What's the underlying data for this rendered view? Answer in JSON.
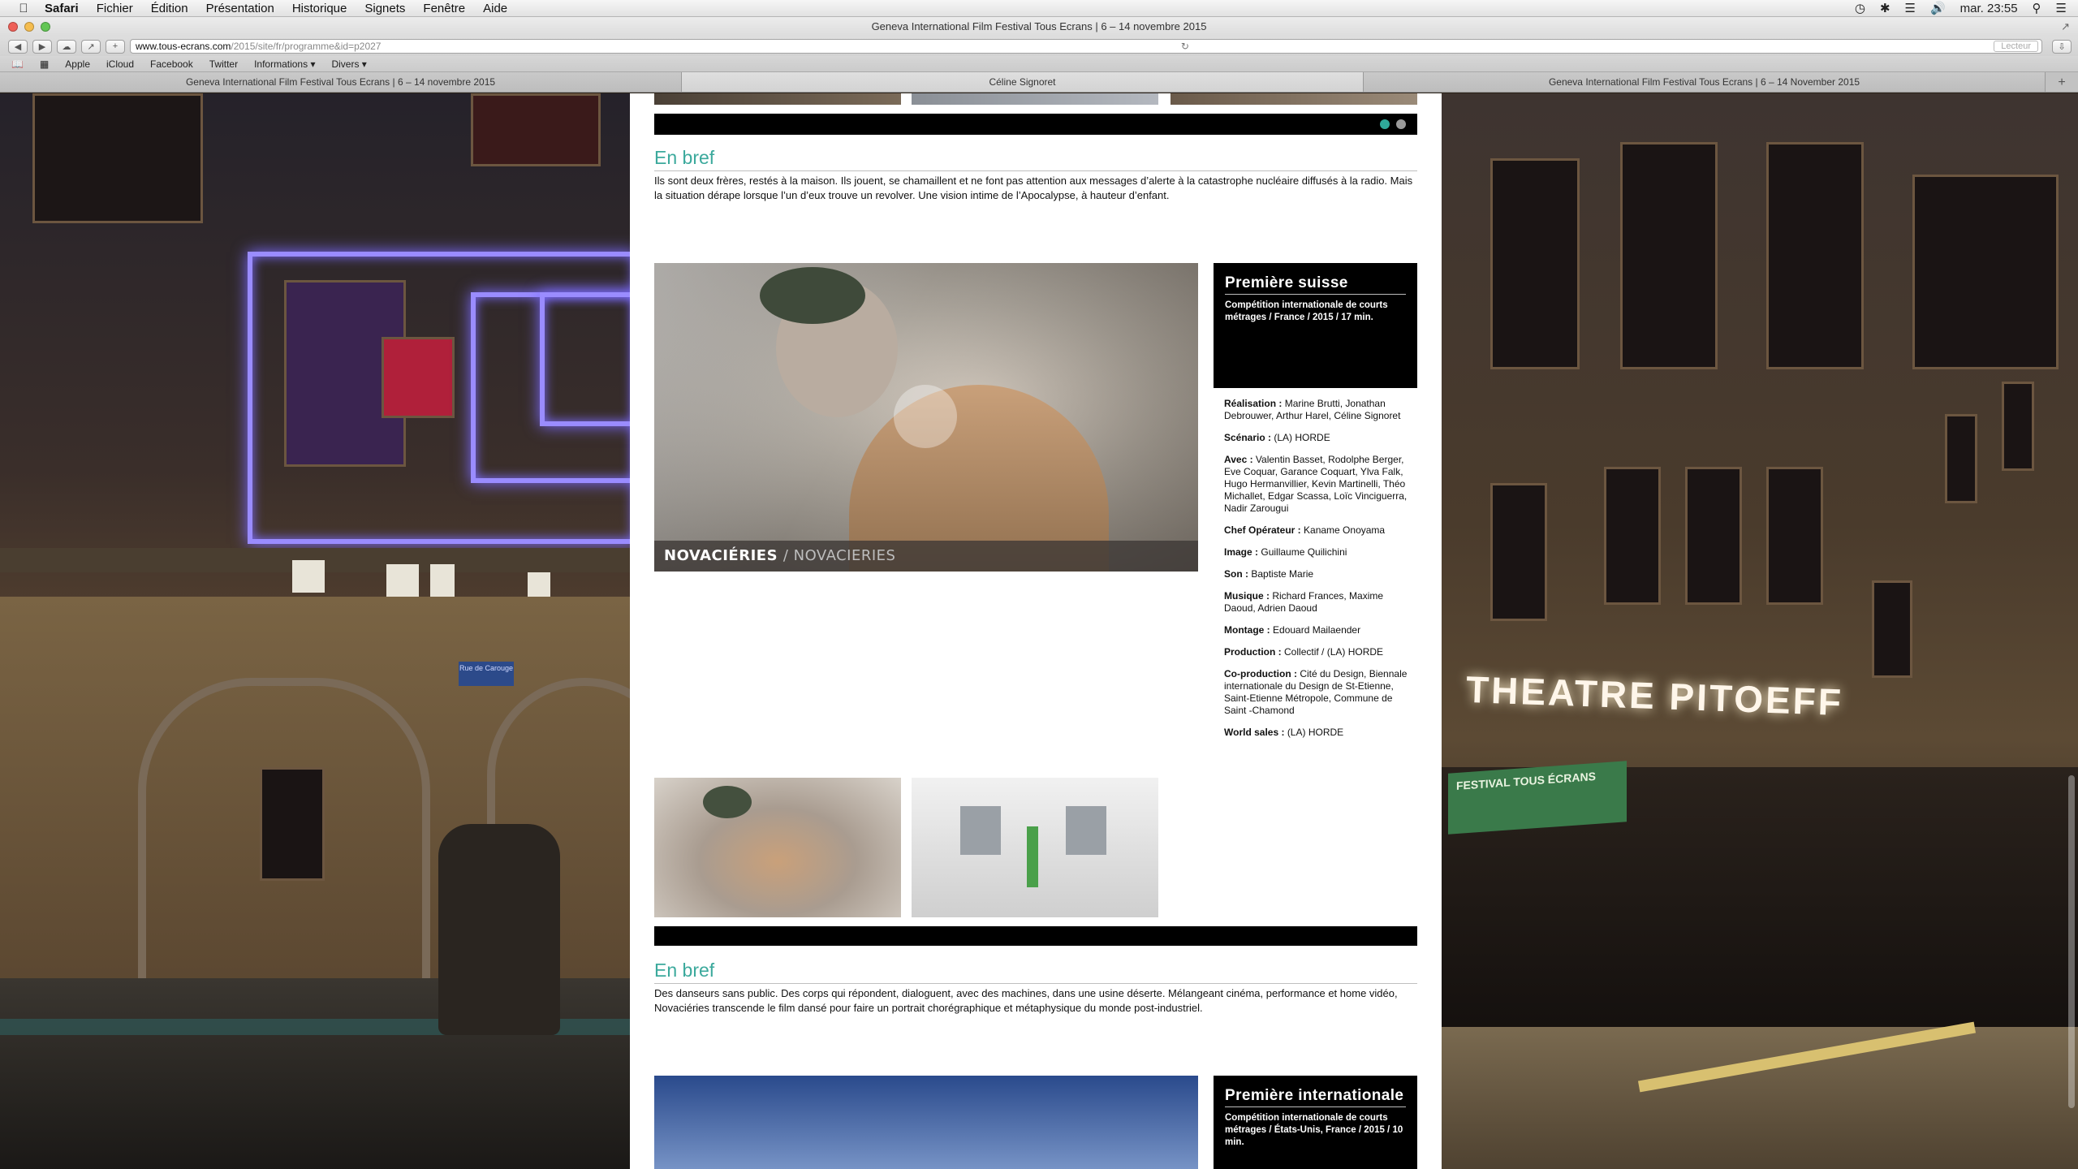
{
  "menubar": {
    "app": "Safari",
    "items": [
      "Fichier",
      "Édition",
      "Présentation",
      "Historique",
      "Signets",
      "Fenêtre",
      "Aide"
    ],
    "clock": "mar. 23:55"
  },
  "window": {
    "title": "Geneva International Film Festival Tous Ecrans | 6 – 14 novembre 2015"
  },
  "toolbar": {
    "url_host": "www.tous-ecrans.com",
    "url_path": "/2015/site/fr/programme&id=p2027",
    "reader_label": "Lecteur"
  },
  "bookmarks": [
    "Apple",
    "iCloud",
    "Facebook",
    "Twitter",
    "Informations ▾",
    "Divers ▾"
  ],
  "tabs": [
    "Geneva International Film Festival Tous Ecrans | 6 – 14 novembre 2015",
    "Céline Signoret",
    "Geneva International Film Festival Tous Ecrans | 6 – 14 November 2015"
  ],
  "background": {
    "theatre_sign": "THEATRE  PITOEFF",
    "street_sign": "Rue de Carouge",
    "banner": "FESTIVAL TOUS ÉCRANS"
  },
  "film1": {
    "section_title": "En bref",
    "synopsis": "Ils sont deux frères, restés à la maison. Ils jouent, se chamaillent et ne font pas attention aux messages d’alerte à la catastrophe nucléaire diffusés à la radio. Mais la situation dérape lorsque l’un d’eux trouve un revolver. Une vision intime de l’Apocalypse, à hauteur d’enfant."
  },
  "film2": {
    "title": "NOVACIÉRIES",
    "original_title": "/ NOVACIERIES",
    "premiere": "Première suisse",
    "category": "Compétition internationale de courts métrages / France / 2015 / 17 min.",
    "credits": [
      {
        "label": "Réalisation :",
        "value": "Marine Brutti, Jonathan Debrouwer, Arthur Harel, Céline Signoret"
      },
      {
        "label": "Scénario :",
        "value": "(LA) HORDE"
      },
      {
        "label": "Avec :",
        "value": "Valentin Basset, Rodolphe Berger, Eve Coquar, Garance Coquart, Ylva Falk, Hugo Hermanvillier, Kevin Martinelli, Théo Michallet, Edgar Scassa, Loïc Vinciguerra, Nadir Zarougui"
      },
      {
        "label": "Chef Opérateur :",
        "value": "Kaname Onoyama"
      },
      {
        "label": "Image :",
        "value": "Guillaume Quilichini"
      },
      {
        "label": "Son :",
        "value": "Baptiste Marie"
      },
      {
        "label": "Musique :",
        "value": "Richard Frances, Maxime Daoud, Adrien Daoud"
      },
      {
        "label": "Montage :",
        "value": "Edouard Mailaender"
      },
      {
        "label": "Production :",
        "value": "Collectif / (LA) HORDE"
      },
      {
        "label": "Co-production :",
        "value": "Cité du Design, Biennale internationale du Design de St-Etienne, Saint-Etienne Métropole, Commune de Saint -Chamond"
      },
      {
        "label": "World sales :",
        "value": "(LA) HORDE"
      }
    ],
    "section_title": "En bref",
    "synopsis": "Des danseurs sans public. Des corps qui répondent, dialoguent, avec des machines, dans une usine déserte. Mélangeant cinéma, performance et home vidéo, Novaciéries transcende le film dansé pour faire un portrait chorégraphique et métaphysique du monde post-industriel."
  },
  "film3": {
    "premiere": "Première internationale",
    "category": "Compétition internationale de courts métrages / États-Unis, France / 2015 / 10 min."
  },
  "colors": {
    "accent": "#3ba99c",
    "dot_active": "#2fa89a",
    "neon": "#9a8cff"
  }
}
